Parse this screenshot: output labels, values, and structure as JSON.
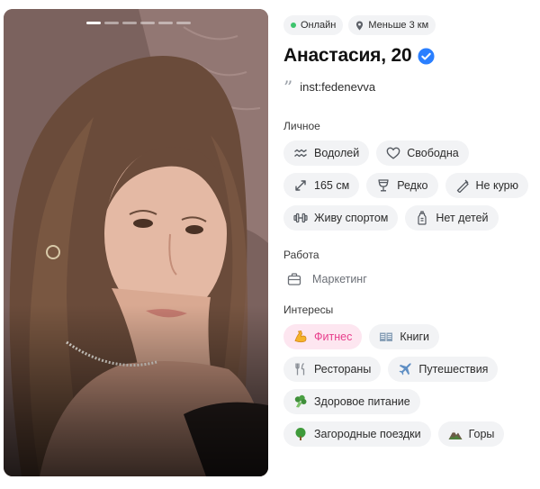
{
  "photo": {
    "pages": 6,
    "active_page": 1
  },
  "status": {
    "online": "Онлайн",
    "distance": "Меньше 3 км",
    "online_color": "#3ec46d"
  },
  "profile": {
    "name": "Анастасия, 20",
    "verified_icon": "verified-badge-icon",
    "instagram": "inst:fedenevva"
  },
  "personal": {
    "title": "Личное",
    "chips": [
      {
        "label": "Водолей",
        "icon": "aquarius-icon"
      },
      {
        "label": "Свободна",
        "icon": "heart-icon"
      },
      {
        "label": "165 см",
        "icon": "expand-arrows-icon"
      },
      {
        "label": "Редко",
        "icon": "wine-glass-icon"
      },
      {
        "label": "Не курю",
        "icon": "no-smoking-icon"
      },
      {
        "label": "Живу спортом",
        "icon": "dumbbell-icon"
      },
      {
        "label": "Нет детей",
        "icon": "baby-bottle-icon"
      }
    ]
  },
  "work": {
    "title": "Работа",
    "value": "Маркетинг",
    "icon": "briefcase-icon"
  },
  "interests": {
    "title": "Интересы",
    "chips": [
      {
        "label": "Фитнес",
        "icon": "flexed-biceps-icon",
        "highlighted": true
      },
      {
        "label": "Книги",
        "icon": "open-book-icon"
      },
      {
        "label": "Рестораны",
        "icon": "fork-knife-icon"
      },
      {
        "label": "Путешествия",
        "icon": "airplane-icon"
      },
      {
        "label": "Здоровое питание",
        "icon": "broccoli-icon"
      },
      {
        "label": "Загородные поездки",
        "icon": "tree-icon"
      },
      {
        "label": "Горы",
        "icon": "mountain-icon"
      }
    ]
  },
  "colors": {
    "accent_pink": "#e83e8c",
    "verified_blue": "#2a7fff",
    "chip_bg": "#f2f3f5"
  }
}
